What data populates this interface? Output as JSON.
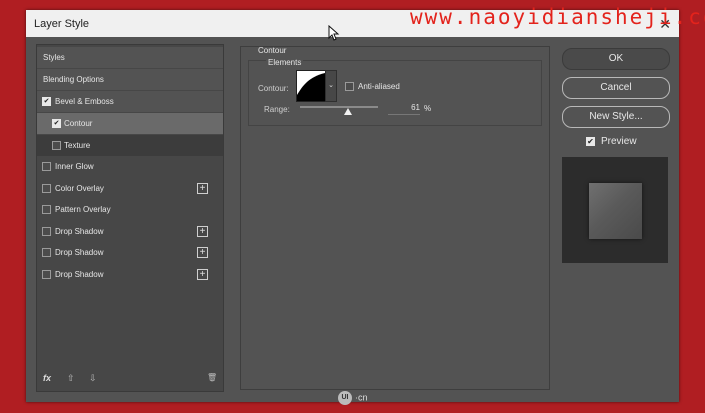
{
  "window": {
    "title": "Layer Style",
    "close": "✕"
  },
  "watermark": "www.naoyidiansheji.com",
  "styles_list": {
    "items": [
      {
        "label": "Styles",
        "checkbox": false,
        "checked": false,
        "plus": false
      },
      {
        "label": "Blending Options",
        "checkbox": false,
        "checked": false,
        "plus": false
      },
      {
        "label": "Bevel & Emboss",
        "checkbox": true,
        "checked": true,
        "plus": false
      },
      {
        "label": "Contour",
        "checkbox": true,
        "checked": true,
        "plus": false
      },
      {
        "label": "Texture",
        "checkbox": true,
        "checked": false,
        "plus": false
      },
      {
        "label": "Inner Glow",
        "checkbox": true,
        "checked": false,
        "plus": false
      },
      {
        "label": "Color Overlay",
        "checkbox": true,
        "checked": false,
        "plus": true
      },
      {
        "label": "Pattern Overlay",
        "checkbox": true,
        "checked": false,
        "plus": false
      },
      {
        "label": "Drop Shadow",
        "checkbox": true,
        "checked": false,
        "plus": true
      },
      {
        "label": "Drop Shadow",
        "checkbox": true,
        "checked": false,
        "plus": true
      },
      {
        "label": "Drop Shadow",
        "checkbox": true,
        "checked": false,
        "plus": true
      }
    ],
    "plus_glyph": "+",
    "check_glyph": "✔",
    "footer": {
      "fx": "fx",
      "up": "⇧",
      "down": "⇩",
      "trash": "🗑"
    }
  },
  "contour_panel": {
    "section_title": "Contour",
    "group_title": "Elements",
    "contour_label": "Contour:",
    "dropdown_glyph": "⌄",
    "anti_aliased_label": "Anti-aliased",
    "anti_aliased_checked": false,
    "range_label": "Range:",
    "range_value": "61",
    "range_unit": "%",
    "range_percent": 61
  },
  "buttons": {
    "ok": "OK",
    "cancel": "Cancel",
    "new_style": "New Style..."
  },
  "preview": {
    "label": "Preview",
    "checked": true,
    "check_glyph": "✔"
  },
  "brand": {
    "mark": "UI",
    "suffix": "·cn"
  }
}
